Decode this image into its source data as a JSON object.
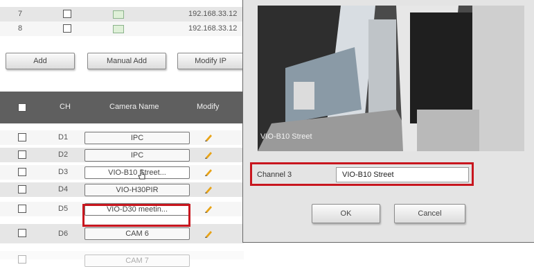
{
  "top_rows": [
    {
      "num": "7",
      "ip": "192.168.33.12"
    },
    {
      "num": "8",
      "ip": "192.168.33.12"
    }
  ],
  "buttons": {
    "add": "Add",
    "manual_add": "Manual Add",
    "modify_ip": "Modify IP"
  },
  "table": {
    "headers": {
      "ch": "CH",
      "camera_name": "Camera Name",
      "modify": "Modify"
    },
    "rows": [
      {
        "ch": "D1",
        "name": "IPC"
      },
      {
        "ch": "D2",
        "name": "IPC"
      },
      {
        "ch": "D3",
        "name": "VIO-B10 Street..."
      },
      {
        "ch": "D4",
        "name": "VIO-H30PIR"
      },
      {
        "ch": "D5",
        "name": "VIO-D30 meetin..."
      },
      {
        "ch": "D6",
        "name": "CAM 6"
      },
      {
        "ch": "",
        "name": "CAM 7"
      }
    ]
  },
  "dialog": {
    "video_overlay": "VIO-B10 Street",
    "channel_label": "Channel 3",
    "channel_value": "VIO-B10 Street",
    "ok_label": "OK",
    "cancel_label": "Cancel"
  },
  "colors": {
    "highlight": "#c8161e",
    "header": "#5f5f5f",
    "pencil": "#e8a317"
  }
}
